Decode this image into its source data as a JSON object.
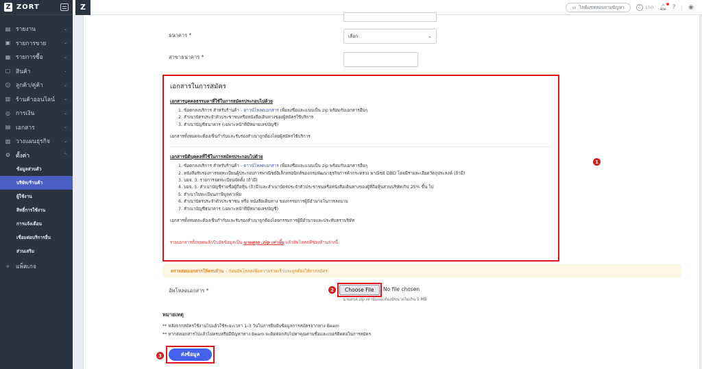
{
  "app": {
    "brand": "ZORT"
  },
  "sidebar": {
    "items": [
      {
        "label": "รายงาน",
        "icon": "chart-icon"
      },
      {
        "label": "รายการขาย",
        "icon": "receipt-icon"
      },
      {
        "label": "รายการซื้อ",
        "icon": "cart-icon"
      },
      {
        "label": "สินค้า",
        "icon": "box-icon"
      },
      {
        "label": "ลูกค้า/คู่ค้า",
        "icon": "users-icon"
      },
      {
        "label": "ร้านค้าออนไลน์",
        "icon": "store-icon"
      },
      {
        "label": "การเงิน",
        "icon": "money-icon"
      },
      {
        "label": "เอกสาร",
        "icon": "document-icon"
      },
      {
        "label": "วางแผนธุรกิจ",
        "icon": "plan-icon"
      },
      {
        "label": "ตั้งค่า",
        "icon": "gear-icon"
      }
    ],
    "settings_sub": [
      "ข้อมูลส่วนตัว",
      "บริษัท/ร้านค้า",
      "ผู้ใช้งาน",
      "สิทธิ์การใช้งาน",
      "การแจ้งเตือน",
      "เชื่อมต่อบริการอื่น",
      "ส่วนเสริม"
    ],
    "package": "แพ็คเกจ"
  },
  "topbar": {
    "help_label": "ไลฟ์แชทสอบถามปัญหา",
    "points": "100"
  },
  "form": {
    "bank_label": "ธนาคาร *",
    "bank_value": "เลือก",
    "branch_label": "สาขาธนาคาร *",
    "upload_label": "อัพโหลดเอกสาร *",
    "choose_file": "Choose File",
    "no_file": "No file chosen",
    "upload_hint": "นามสกุล zip เท่านั้นและต้องมีขนาดไม่เกิน 5 MB",
    "submit": "ส่งข้อมูล"
  },
  "documents": {
    "title": "เอกสารในการสมัคร",
    "individual": {
      "heading": "เอกสารบุคคลธรรมดาที่ใช้ในการสมัครประกอบไปด้วย",
      "items": [
        {
          "pre": "1. ข้อตกลงบริการ สำหรับร้านค้า - ",
          "link": "ดาวน์โหลดเอกสาร",
          "post": " เพื่อลงชื่อและแนบเป็น zip พร้อมกับเอกสารอื่นๆ"
        },
        {
          "pre": "2. สำเนาบัตรประจำตัวประชาชนหรือหนังสือเดินทางของผู้สมัครใช้บริการ",
          "link": "",
          "post": ""
        },
        {
          "pre": "3. สำเนาบัญชีธนาคาร (เฉพาะหน้าที่มีหมายเลขบัญชี)",
          "link": "",
          "post": ""
        }
      ],
      "note": "เอกสารทั้งหมดจะต้องเซ็นกำกับและรับรองสำเนาถูกต้องโดยผู้สมัครใช้บริการ"
    },
    "juristic": {
      "heading": "เอกสารนิติบุคคลที่ใช้ในการสมัครประกอบไปด้วย",
      "items": [
        {
          "pre": "1. ข้อตกลงบริการ สำหรับร้านค้า - ",
          "link": "ดาวน์โหลดเอกสาร",
          "post": " เพื่อลงชื่อและแนบเป็น zip พร้อมกับเอกสารอื่นๆ"
        },
        {
          "pre": "2. หนังสือรับรองการจดทะเบียนผู้ประกอบการพาณิชย์อิเล็กทรอนิกส์ของกรมพัฒนาธุรกิจการค้ากระทรวง พาณิชย์ DBD โดยมีรายละเอียดวัตถุประสงค์ (ถ้ามี)",
          "link": "",
          "post": ""
        },
        {
          "pre": "3. บอจ. 3. รายการจดทะเบียนจัดตั้ง (ถ้ามี)",
          "link": "",
          "post": ""
        },
        {
          "pre": "4. บอจ. 5. สำเนาบัญชีรายชื่อผู้ถือหุ้น (ถ้ามี)และสำเนาบัตรประจำตัวประชาชนหรือหนังสือเดินทางของผู้ที่ถือหุ้นส่วนบริษัทเกิน 25% ขึ้น ไป",
          "link": "",
          "post": ""
        },
        {
          "pre": "5. สำเนาใบทะเบียนภาษีมูลค่าเพิ่ม",
          "link": "",
          "post": ""
        },
        {
          "pre": "6. สำเนาบัตรประจำตัวประชาชน หรือ หนังสือเดินทาง ของกรรมการผู้มีอำนาจในการลงนาม",
          "link": "",
          "post": ""
        },
        {
          "pre": "7. สำเนาบัญชีธนาคาร (เฉพาะหน้าที่มีหมายเลขบัญชี)",
          "link": "",
          "post": ""
        }
      ],
      "note": "เอกสารทั้งหมดจะต้องเซ็นกำกับและรับรองสำเนาถูกต้องโดยกรรมการผู้มีอำนาจและประทับตราบริษัท"
    },
    "warning_pre": "รวมเอกสารทั้งหมดแล้วบีบอัดข้อมูลเป็น ",
    "warning_zip": "นามสกุล .zip เท่านั้น",
    "warning_post": " แล้วอัพโหลดที่ช่องด้านล่างนี้"
  },
  "verify": {
    "bold": "ตรวจสอบเอกสารให้ครบถ้วน",
    "text": "- ก่อนอัพโหลดเพื่อความรวดเร็วและถูกต้องให้การสมัคร"
  },
  "remarks": {
    "title": "หมายเหตุ",
    "lines": [
      "** หลังจากสมัครใช้งานไปแล้วใช้ระยะเวลา 1-3 วันในการยืนยันข้อมูลการสมัครจากทาง Beam",
      "** หากส่งเอกสารไปแล้วไม่ครบหรือมีปัญหาทาง Beam จะติดต่อกลับไปหาคุณตามชื่อและเบอร์ติดต่อในการสมัคร"
    ]
  },
  "markers": [
    "1",
    "2",
    "3"
  ],
  "colors": {
    "accent": "#4361ee",
    "highlight": "#e0121b",
    "sidebar": "#2b3341",
    "active": "#4a5ec4"
  }
}
